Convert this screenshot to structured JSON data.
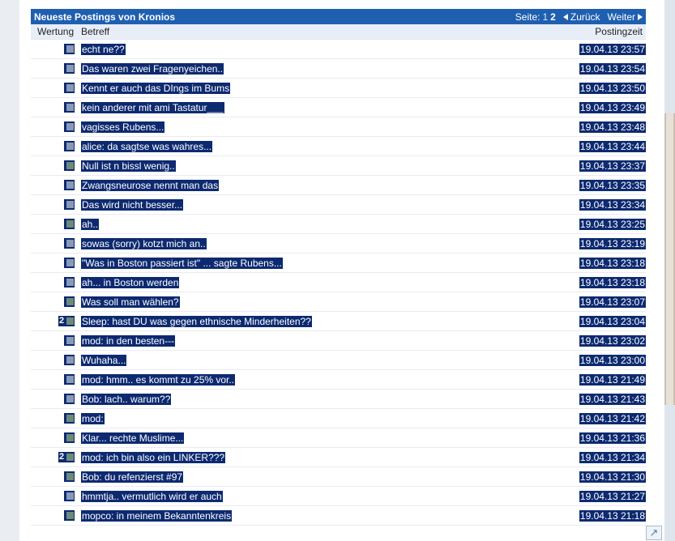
{
  "header": {
    "title": "Neueste Postings von Kronios",
    "pager_label": "Seite:",
    "pages": [
      "1",
      "2"
    ],
    "current_page": "2",
    "prev_label": "Zurück",
    "next_label": "Weiter"
  },
  "columns": {
    "rating": "Wertung",
    "subject": "Betreff",
    "time": "Postingzeit"
  },
  "rows": [
    {
      "rating": "",
      "icon": "square",
      "subject": "echt ne??",
      "time": "19.04.13 23:57"
    },
    {
      "rating": "",
      "icon": "square",
      "subject": "Das waren zwei Fragenyeichen..",
      "time": "19.04.13 23:54"
    },
    {
      "rating": "",
      "icon": "square",
      "subject": "Kennt er auch das DIngs im Bums",
      "time": "19.04.13 23:50"
    },
    {
      "rating": "",
      "icon": "square",
      "subject": "kein anderer mit ami Tastatur___",
      "time": "19.04.13 23:49"
    },
    {
      "rating": "",
      "icon": "square",
      "subject": "vagisses Rubens...",
      "time": "19.04.13 23:48"
    },
    {
      "rating": "",
      "icon": "square",
      "subject": "alice: da sagtse was wahres...",
      "time": "19.04.13 23:44"
    },
    {
      "rating": "",
      "icon": "star",
      "subject": "Null ist n bissl wenig..",
      "time": "19.04.13 23:37"
    },
    {
      "rating": "",
      "icon": "square",
      "subject": "Zwangsneurose nennt man das",
      "time": "19.04.13 23:35"
    },
    {
      "rating": "",
      "icon": "square",
      "subject": "Das wird nicht besser...",
      "time": "19.04.13 23:34"
    },
    {
      "rating": "",
      "icon": "star",
      "subject": "ah..",
      "time": "19.04.13 23:25"
    },
    {
      "rating": "",
      "icon": "square",
      "subject": "sowas (sorry) kotzt mich an..",
      "time": "19.04.13 23:19"
    },
    {
      "rating": "",
      "icon": "square",
      "subject": "\"Was in Boston passiert ist\" ... sagte Rubens...",
      "time": "19.04.13 23:18"
    },
    {
      "rating": "",
      "icon": "square",
      "subject": "ah... in Boston werden",
      "time": "19.04.13 23:18"
    },
    {
      "rating": "",
      "icon": "star",
      "subject": "Was soll man wählen?",
      "time": "19.04.13 23:07"
    },
    {
      "rating": "2",
      "icon": "star",
      "subject": "Sleep: hast DU was gegen ethnische Minderheiten??",
      "time": "19.04.13 23:04"
    },
    {
      "rating": "",
      "icon": "square",
      "subject": "mod: in den besten---",
      "time": "19.04.13 23:02"
    },
    {
      "rating": "",
      "icon": "square",
      "subject": "Wuhaha...",
      "time": "19.04.13 23:00"
    },
    {
      "rating": "",
      "icon": "square",
      "subject": "mod: hmm.. es kommt zu 25% vor..",
      "time": "19.04.13 21:49"
    },
    {
      "rating": "",
      "icon": "square",
      "subject": "Bob: lach.. warum??",
      "time": "19.04.13 21:43"
    },
    {
      "rating": "",
      "icon": "star",
      "subject": "mod:",
      "time": "19.04.13 21:42"
    },
    {
      "rating": "",
      "icon": "star",
      "subject": "Klar... rechte Muslime...",
      "time": "19.04.13 21:36"
    },
    {
      "rating": "2",
      "icon": "star",
      "subject": "mod: ich bin also ein LINKER???",
      "time": "19.04.13 21:34"
    },
    {
      "rating": "",
      "icon": "star",
      "subject": "Bob: du refenzierst #97",
      "time": "19.04.13 21:30"
    },
    {
      "rating": "",
      "icon": "square",
      "subject": "hmmtja.. vermutlich wird er auch",
      "time": "19.04.13 21:27"
    },
    {
      "rating": "",
      "icon": "star",
      "subject": "mopco: in meinem Bekanntenkreis",
      "time": "19.04.13 21:18"
    }
  ]
}
